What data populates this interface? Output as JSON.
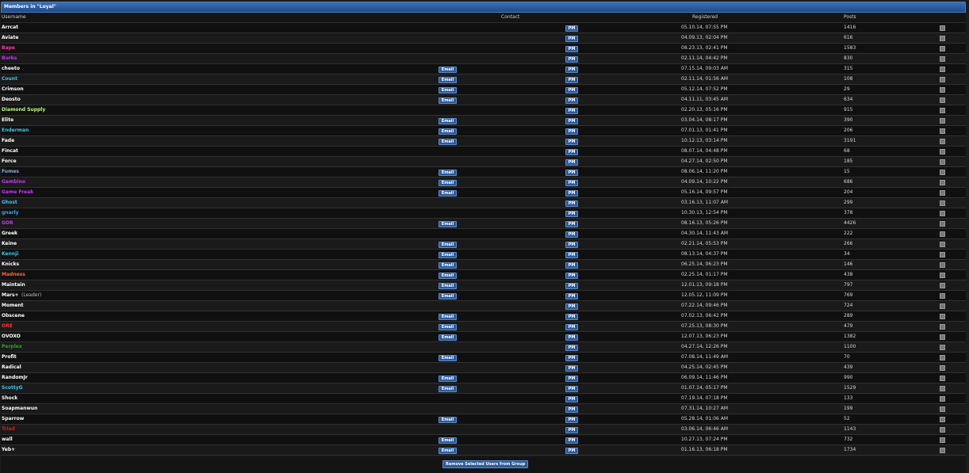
{
  "group_title": "Members in \"Loyal\"",
  "columns": {
    "username": "Username",
    "contact": "Contact",
    "registered": "Registered",
    "posts": "Posts"
  },
  "email_label": "Email",
  "pm_label": "PM",
  "leader_label": "(Leader)",
  "remove_button_label": "Remove Selected Users from Group",
  "members": [
    {
      "name": "Arrcat",
      "color": "#ffffff",
      "email": false,
      "registered": "05.10.14, 07:55 PM",
      "posts": "1416"
    },
    {
      "name": "Aviate",
      "color": "#ffffff",
      "email": false,
      "registered": "04.09.13, 02:04 PM",
      "posts": "616"
    },
    {
      "name": "Bape",
      "color": "#ff3aa8",
      "email": false,
      "registered": "08.23.13, 02:41 PM",
      "posts": "1583"
    },
    {
      "name": "Burks",
      "color": "#cc33ff",
      "email": false,
      "registered": "02.11.14, 04:42 PM",
      "posts": "830"
    },
    {
      "name": "cheeto",
      "color": "#ffffff",
      "email": true,
      "registered": "07.15.14, 09:03 AM",
      "posts": "315"
    },
    {
      "name": "Count",
      "color": "#33c8f0",
      "email": true,
      "registered": "02.11.14, 01:56 AM",
      "posts": "108"
    },
    {
      "name": "Crimson",
      "color": "#ffffff",
      "email": true,
      "registered": "05.12.14, 07:52 PM",
      "posts": "29"
    },
    {
      "name": "Deosto",
      "color": "#ffffff",
      "email": true,
      "registered": "04.11.11, 03:45 AM",
      "posts": "634"
    },
    {
      "name": "Diamond Supply",
      "color": "#b6ff7a",
      "email": false,
      "registered": "02.20.13, 05:16 PM",
      "posts": "915"
    },
    {
      "name": "Elite",
      "color": "#ffffff",
      "email": true,
      "registered": "03.04.14, 08:17 PM",
      "posts": "390"
    },
    {
      "name": "Enderman",
      "color": "#33c8f0",
      "email": true,
      "registered": "07.01.13, 01:41 PM",
      "posts": "206"
    },
    {
      "name": "Fade",
      "color": "#ffffff",
      "email": true,
      "registered": "10.12.13, 03:14 PM",
      "posts": "3191"
    },
    {
      "name": "Fincat",
      "color": "#ffffff",
      "email": false,
      "registered": "08.07.14, 04:48 PM",
      "posts": "68"
    },
    {
      "name": "Force",
      "color": "#ffffff",
      "email": false,
      "registered": "04.27.14, 02:50 PM",
      "posts": "185"
    },
    {
      "name": "Fumes",
      "color": "#8ea8d8",
      "email": true,
      "registered": "08.06.14, 11:20 PM",
      "posts": "15"
    },
    {
      "name": "Gambino",
      "color": "#cc33ff",
      "email": true,
      "registered": "04.09.14, 10:22 PM",
      "posts": "686"
    },
    {
      "name": "Game Freak",
      "color": "#cc33ff",
      "email": true,
      "registered": "05.16.14, 09:57 PM",
      "posts": "204"
    },
    {
      "name": "Ghost",
      "color": "#33c8f0",
      "email": false,
      "registered": "03.16.13, 11:07 AM",
      "posts": "299"
    },
    {
      "name": "gnarly",
      "color": "#33a8f0",
      "email": false,
      "registered": "10.30.13, 12:54 PM",
      "posts": "378"
    },
    {
      "name": "GOR",
      "color": "#cc33ff",
      "email": true,
      "registered": "08.16.13, 05:26 PM",
      "posts": "4426"
    },
    {
      "name": "Greek",
      "color": "#ffffff",
      "email": false,
      "registered": "04.30.14, 11:43 AM",
      "posts": "222"
    },
    {
      "name": "Keine",
      "color": "#ffffff",
      "email": true,
      "registered": "02.21.14, 05:53 PM",
      "posts": "266"
    },
    {
      "name": "Kennji",
      "color": "#33c8f0",
      "email": true,
      "registered": "08.13.14, 04:37 PM",
      "posts": "34"
    },
    {
      "name": "Knicks",
      "color": "#ffffff",
      "email": true,
      "registered": "06.25.14, 06:23 PM",
      "posts": "146"
    },
    {
      "name": "Madness",
      "color": "#ff6a33",
      "email": true,
      "registered": "02.25.14, 01:17 PM",
      "posts": "438"
    },
    {
      "name": "Maintain",
      "color": "#ffffff",
      "email": true,
      "registered": "12.01.13, 09:18 PM",
      "posts": "797"
    },
    {
      "name": "Mars+",
      "color": "#ffffff",
      "email": true,
      "leader": true,
      "registered": "12.05.12, 11:09 PM",
      "posts": "769"
    },
    {
      "name": "Moment",
      "color": "#ffffff",
      "email": false,
      "registered": "07.22.14, 09:46 PM",
      "posts": "724"
    },
    {
      "name": "Obscene",
      "color": "#ffffff",
      "email": true,
      "registered": "07.02.13, 06:42 PM",
      "posts": "289"
    },
    {
      "name": "ORE",
      "color": "#ff3030",
      "email": true,
      "registered": "07.25.13, 08:30 PM",
      "posts": "479"
    },
    {
      "name": "OVOXO",
      "color": "#ffffff",
      "email": true,
      "registered": "12.07.13, 06:23 PM",
      "posts": "1382"
    },
    {
      "name": "Perplex",
      "color": "#22aa22",
      "email": false,
      "registered": "04.27.14, 12:26 PM",
      "posts": "1100"
    },
    {
      "name": "Profit",
      "color": "#ffffff",
      "email": true,
      "registered": "07.08.14, 11:49 AM",
      "posts": "70"
    },
    {
      "name": "Radical",
      "color": "#ffffff",
      "email": false,
      "registered": "04.25.14, 02:45 PM",
      "posts": "439"
    },
    {
      "name": "RandomJr",
      "color": "#ffffff",
      "email": true,
      "registered": "06.09.14, 11:46 PM",
      "posts": "990"
    },
    {
      "name": "ScottyG",
      "color": "#33c8f0",
      "email": true,
      "registered": "01.07.14, 05:17 PM",
      "posts": "1529"
    },
    {
      "name": "Shock",
      "color": "#ffffff",
      "email": false,
      "registered": "07.19.14, 07:18 PM",
      "posts": "133"
    },
    {
      "name": "Soapmanwun",
      "color": "#ffffff",
      "email": false,
      "registered": "07.31.14, 10:27 AM",
      "posts": "199"
    },
    {
      "name": "Sparrow",
      "color": "#ffffff",
      "email": true,
      "registered": "05.28.14, 01:06 AM",
      "posts": "52"
    },
    {
      "name": "Triad",
      "color": "#cc2020",
      "email": false,
      "registered": "03.06.14, 06:46 AM",
      "posts": "1143"
    },
    {
      "name": "wall",
      "color": "#ffffff",
      "email": true,
      "registered": "10.27.13, 07:24 PM",
      "posts": "732"
    },
    {
      "name": "Yeb+",
      "color": "#ffffff",
      "email": true,
      "registered": "01.16.13, 06:18 PM",
      "posts": "1734"
    }
  ]
}
